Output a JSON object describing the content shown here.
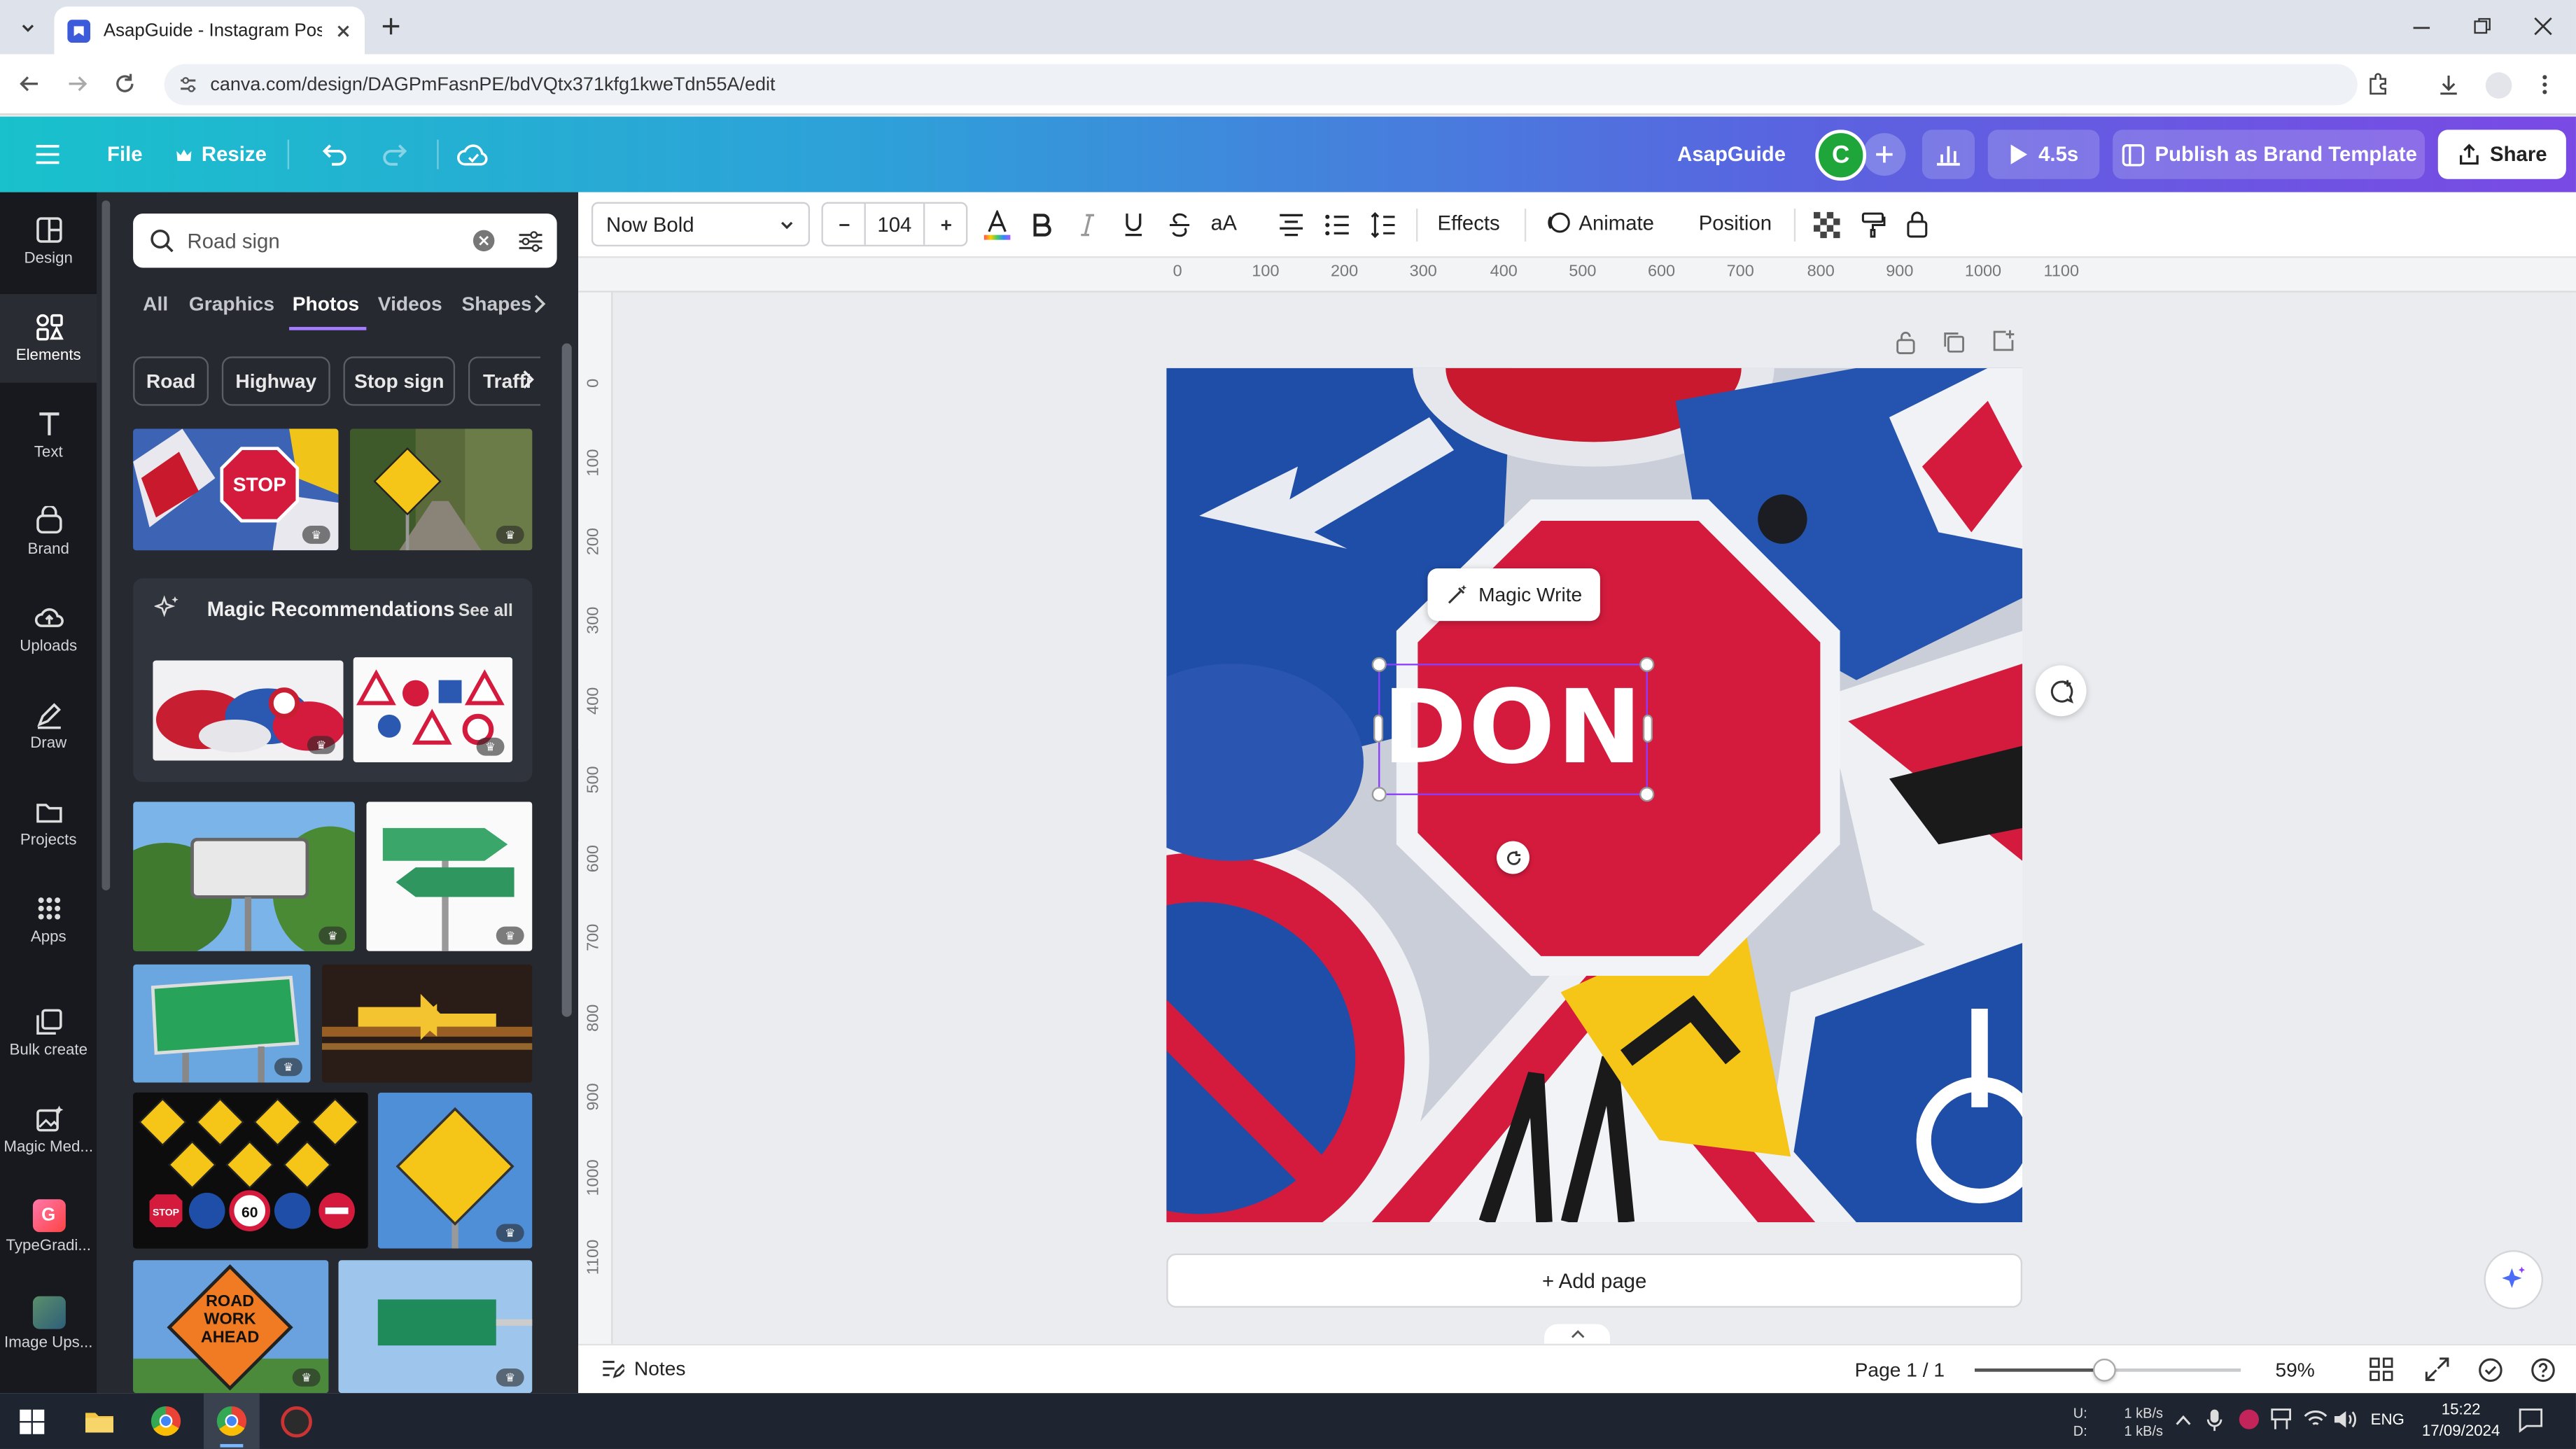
{
  "browser": {
    "tab_title": "AsapGuide - Instagram Post",
    "url": "canva.com/design/DAGPmFasnPE/bdVQtx371kfg1kweTdn55A/edit"
  },
  "header": {
    "file_label": "File",
    "resize_label": "Resize",
    "workspace_name": "AsapGuide",
    "avatar_letter": "C",
    "present_duration": "4.5s",
    "publish_label": "Publish as Brand Template",
    "share_label": "Share"
  },
  "rail": {
    "items": [
      {
        "label": "Design",
        "icon": "design-icon"
      },
      {
        "label": "Elements",
        "icon": "elements-icon"
      },
      {
        "label": "Text",
        "icon": "text-icon"
      },
      {
        "label": "Brand",
        "icon": "brand-icon"
      },
      {
        "label": "Uploads",
        "icon": "uploads-icon"
      },
      {
        "label": "Draw",
        "icon": "draw-icon"
      },
      {
        "label": "Projects",
        "icon": "projects-icon"
      },
      {
        "label": "Apps",
        "icon": "apps-icon"
      },
      {
        "label": "Bulk create",
        "icon": "bulk-create-icon"
      },
      {
        "label": "Magic Med...",
        "icon": "magic-media-icon"
      },
      {
        "label": "TypeGradi...",
        "icon": "typegradient-app-icon"
      },
      {
        "label": "Image Ups...",
        "icon": "image-upscaler-app-icon"
      }
    ]
  },
  "panel": {
    "search_value": "Road sign",
    "filter_tabs": [
      "All",
      "Graphics",
      "Photos",
      "Videos",
      "Shapes"
    ],
    "active_tab": "Photos",
    "chips": [
      "Road",
      "Highway",
      "Stop sign",
      "Traffi"
    ],
    "magic_title": "Magic Recommendations",
    "see_all": "See all"
  },
  "toolbar": {
    "font_name": "Now Bold",
    "font_size": "104",
    "effects_label": "Effects",
    "animate_label": "Animate",
    "position_label": "Position"
  },
  "rulers": {
    "h_ticks": [
      "0",
      "100",
      "200",
      "300",
      "400",
      "500",
      "600",
      "700",
      "800",
      "900",
      "1000",
      "1100"
    ],
    "v_ticks": [
      "0",
      "100",
      "200",
      "300",
      "400",
      "500",
      "600",
      "700",
      "800",
      "900",
      "1000",
      "1100"
    ]
  },
  "canvas": {
    "magic_write_label": "Magic Write",
    "selected_text": "DON",
    "stop_sign_text": "STOP",
    "road_work_text": "ROAD WORK AHEAD",
    "speed_text": "60",
    "add_page_label": "+ Add page"
  },
  "bottom": {
    "notes_label": "Notes",
    "page_indicator": "Page 1 / 1",
    "zoom_value": 0.59,
    "zoom_label": "59%"
  },
  "taskbar": {
    "net_up_label": "U:",
    "net_down_label": "D:",
    "net_up": "1 kB/s",
    "net_down": "1 kB/s",
    "language": "ENG",
    "time": "15:22",
    "date": "17/09/2024"
  },
  "colors": {
    "accent": "#8b3dff",
    "stop_red": "#d41b3e",
    "sign_blue": "#1f4ea8",
    "sign_green": "#3aa66a",
    "sign_yellow": "#f5c518"
  }
}
